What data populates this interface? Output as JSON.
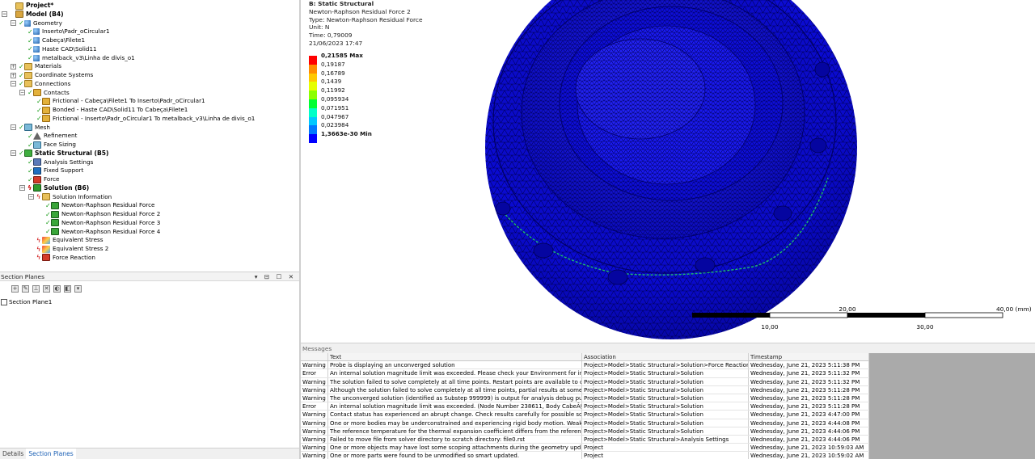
{
  "tree": {
    "nodes": [
      {
        "label": "Project*",
        "level": 0,
        "icon": "folder",
        "bold": true,
        "exp": "",
        "check": ""
      },
      {
        "label": "Model (B4)",
        "level": 0,
        "icon": "model",
        "bold": true,
        "exp": "-",
        "check": ""
      },
      {
        "label": "Geometry",
        "level": 1,
        "icon": "body",
        "bold": false,
        "exp": "-",
        "check": "green"
      },
      {
        "label": "Inserto\\Padr_oCircular1",
        "level": 2,
        "icon": "body",
        "bold": false,
        "exp": "",
        "check": "green"
      },
      {
        "label": "Cabeça\\Filete1",
        "level": 2,
        "icon": "body",
        "bold": false,
        "exp": "",
        "check": "green"
      },
      {
        "label": "Haste CAD\\Solid11",
        "level": 2,
        "icon": "body",
        "bold": false,
        "exp": "",
        "check": "green"
      },
      {
        "label": "metalback_v3\\Linha de divis_o1",
        "level": 2,
        "icon": "body",
        "bold": false,
        "exp": "",
        "check": "green"
      },
      {
        "label": "Materials",
        "level": 1,
        "icon": "folder",
        "bold": false,
        "exp": "+",
        "check": "green"
      },
      {
        "label": "Coordinate Systems",
        "level": 1,
        "icon": "folder",
        "bold": false,
        "exp": "+",
        "check": "green"
      },
      {
        "label": "Connections",
        "level": 1,
        "icon": "folder",
        "bold": false,
        "exp": "-",
        "check": "green"
      },
      {
        "label": "Contacts",
        "level": 2,
        "icon": "contact",
        "bold": false,
        "exp": "-",
        "check": "green"
      },
      {
        "label": "Frictional - Cabeça\\Filete1 To Inserto\\Padr_oCircular1",
        "level": 3,
        "icon": "contact",
        "bold": false,
        "exp": "",
        "check": "green"
      },
      {
        "label": "Bonded - Haste CAD\\Solid11 To Cabeça\\Filete1",
        "level": 3,
        "icon": "contact",
        "bold": false,
        "exp": "",
        "check": "green"
      },
      {
        "label": "Frictional - Inserto\\Padr_oCircular1 To metalback_v3\\Linha de divis_o1",
        "level": 3,
        "icon": "contact",
        "bold": false,
        "exp": "",
        "check": "green"
      },
      {
        "label": "Mesh",
        "level": 1,
        "icon": "mesh",
        "bold": false,
        "exp": "-",
        "check": "green"
      },
      {
        "label": "Refinement",
        "level": 2,
        "icon": "ref",
        "bold": false,
        "exp": "",
        "check": "green"
      },
      {
        "label": "Face Sizing",
        "level": 2,
        "icon": "mesh",
        "bold": false,
        "exp": "",
        "check": "green"
      },
      {
        "label": "Static Structural (B5)",
        "level": 1,
        "icon": "ss",
        "bold": true,
        "exp": "-",
        "check": "green"
      },
      {
        "label": "Analysis Settings",
        "level": 2,
        "icon": "settings",
        "bold": false,
        "exp": "",
        "check": "green"
      },
      {
        "label": "Fixed Support",
        "level": 2,
        "icon": "support",
        "bold": false,
        "exp": "",
        "check": "green"
      },
      {
        "label": "Force",
        "level": 2,
        "icon": "force",
        "bold": false,
        "exp": "",
        "check": "green"
      },
      {
        "label": "Solution (B6)",
        "level": 2,
        "icon": "sol",
        "bold": true,
        "exp": "-",
        "check": "red"
      },
      {
        "label": "Solution Information",
        "level": 3,
        "icon": "folder",
        "bold": false,
        "exp": "-",
        "check": "red"
      },
      {
        "label": "Newton-Raphson Residual Force",
        "level": 4,
        "icon": "res",
        "bold": false,
        "exp": "",
        "check": "green"
      },
      {
        "label": "Newton-Raphson Residual Force 2",
        "level": 4,
        "icon": "res",
        "bold": false,
        "exp": "",
        "check": "green"
      },
      {
        "label": "Newton-Raphson Residual Force 3",
        "level": 4,
        "icon": "res",
        "bold": false,
        "exp": "",
        "check": "green"
      },
      {
        "label": "Newton-Raphson Residual Force 4",
        "level": 4,
        "icon": "res",
        "bold": false,
        "exp": "",
        "check": "green"
      },
      {
        "label": "Equivalent Stress",
        "level": 3,
        "icon": "stress",
        "bold": false,
        "exp": "",
        "check": "red"
      },
      {
        "label": "Equivalent Stress 2",
        "level": 3,
        "icon": "stress",
        "bold": false,
        "exp": "",
        "check": "red"
      },
      {
        "label": "Force Reaction",
        "level": 3,
        "icon": "force",
        "bold": false,
        "exp": "",
        "check": "red"
      }
    ]
  },
  "section_planes": {
    "title": "Section Planes",
    "controls": "▾ ⊟ ☐ ✕",
    "items": [
      {
        "label": "Section Plane1"
      }
    ]
  },
  "bottom_tabs": [
    {
      "label": "Details",
      "active": false
    },
    {
      "label": "Section Planes",
      "active": true
    }
  ],
  "viewport": {
    "title": "B: Static Structural",
    "line2": "Newton-Raphson Residual Force 2",
    "type": "Type: Newton-Raphson Residual Force",
    "unit": "Unit: N",
    "time": "Time: 0,79009",
    "date": "21/06/2023 17:47"
  },
  "legend": [
    {
      "label": "0,21585 Max",
      "color": "#ff0000",
      "bold": true
    },
    {
      "label": "0,19187",
      "color": "#ff8c00",
      "bold": false
    },
    {
      "label": "0,16789",
      "color": "#ffc800",
      "bold": false
    },
    {
      "label": "0,1439",
      "color": "#e6ff00",
      "bold": false
    },
    {
      "label": "0,11992",
      "color": "#8cff00",
      "bold": false
    },
    {
      "label": "0,095934",
      "color": "#00ff32",
      "bold": false
    },
    {
      "label": "0,071951",
      "color": "#00ffc8",
      "bold": false
    },
    {
      "label": "0,047967",
      "color": "#00c8ff",
      "bold": false
    },
    {
      "label": "0,023984",
      "color": "#0078ff",
      "bold": false
    },
    {
      "label": "1,3663e-30 Min",
      "color": "#0000ff",
      "bold": true
    }
  ],
  "scale": {
    "top_labels": [
      "20,00",
      "40,00 (mm)"
    ],
    "bottom_labels": [
      "10,00",
      "30,00"
    ]
  },
  "messages": {
    "title": "Messages",
    "columns": [
      "Text",
      "Association",
      "Timestamp"
    ],
    "rows": [
      {
        "type": "Warning",
        "text": "Probe is displaying an unconverged solution",
        "assoc": "Project>Model>Static Structural>Solution>Force Reaction",
        "time": "Wednesday, June 21, 2023 5:11:38 PM"
      },
      {
        "type": "Error",
        "text": "An internal solution magnitude limit was exceeded. Please check your Environment for inap",
        "assoc": "Project>Model>Static Structural>Solution",
        "time": "Wednesday, June 21, 2023 5:11:32 PM"
      },
      {
        "type": "Warning",
        "text": "The solution failed to solve completely at all time points. Restart points are available to con",
        "assoc": "Project>Model>Static Structural>Solution",
        "time": "Wednesday, June 21, 2023 5:11:32 PM"
      },
      {
        "type": "Warning",
        "text": "Although the solution failed to solve completely at all time points, partial results at some po",
        "assoc": "Project>Model>Static Structural>Solution",
        "time": "Wednesday, June 21, 2023 5:11:28 PM"
      },
      {
        "type": "Warning",
        "text": "The unconverged solution (identified as Substep 999999) is output for analysis debug purp",
        "assoc": "Project>Model>Static Structural>Solution",
        "time": "Wednesday, June 21, 2023 5:11:28 PM"
      },
      {
        "type": "Error",
        "text": "An internal solution magnitude limit was exceeded. (Node Number 238611, Body CabeÃ§a\\Fi",
        "assoc": "Project>Model>Static Structural>Solution",
        "time": "Wednesday, June 21, 2023 5:11:28 PM"
      },
      {
        "type": "Warning",
        "text": "Contact status has experienced an abrupt change.  Check results carefully for possible solu",
        "assoc": "Project>Model>Static Structural>Solution",
        "time": "Wednesday, June 21, 2023 4:47:00 PM"
      },
      {
        "type": "Warning",
        "text": "One or more bodies may be underconstrained and experiencing rigid body motion. Weak s",
        "assoc": "Project>Model>Static Structural>Solution",
        "time": "Wednesday, June 21, 2023 4:44:08 PM"
      },
      {
        "type": "Warning",
        "text": "The reference temperature for the thermal expansion coefficient differs from the referenc",
        "assoc": "Project>Model>Static Structural>Solution",
        "time": "Wednesday, June 21, 2023 4:44:06 PM"
      },
      {
        "type": "Warning",
        "text": "Failed to move file from solver directory to scratch directory: file0.rst",
        "assoc": "Project>Model>Static Structural>Analysis Settings",
        "time": "Wednesday, June 21, 2023 4:44:06 PM"
      },
      {
        "type": "Warning",
        "text": "One or more objects may have lost some scoping attachments during the geometry update",
        "assoc": "Project",
        "time": "Wednesday, June 21, 2023 10:59:03 AM"
      },
      {
        "type": "Warning",
        "text": "One or more parts were found to be unmodified so smart updated.",
        "assoc": "Project",
        "time": "Wednesday, June 21, 2023 10:59:02 AM"
      }
    ]
  }
}
